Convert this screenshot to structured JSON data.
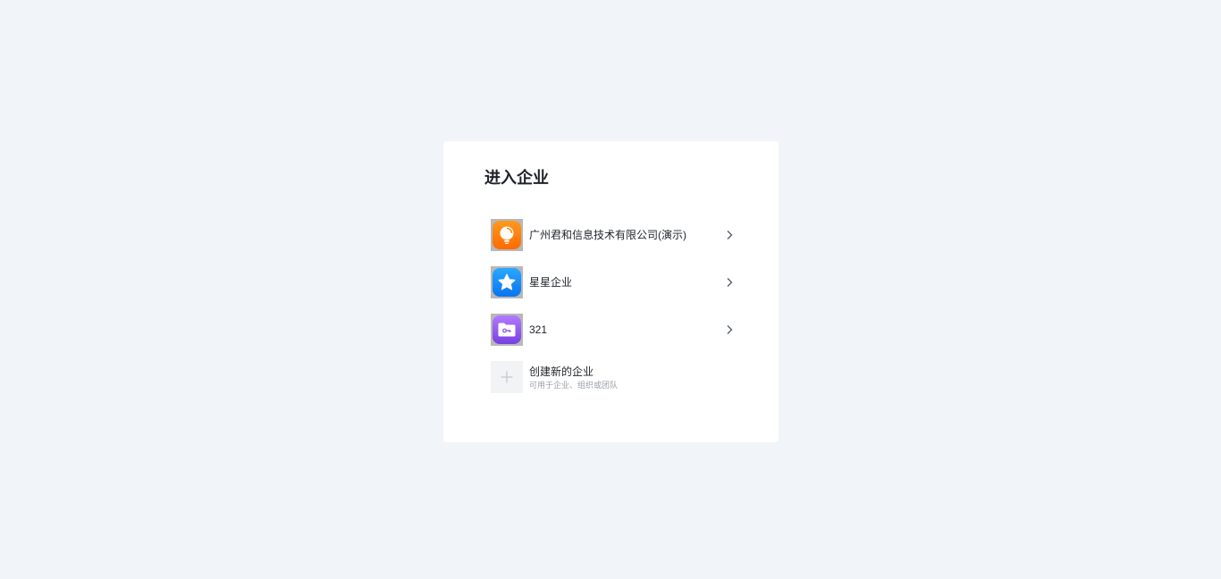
{
  "card": {
    "title": "进入企业"
  },
  "organizations": [
    {
      "name": "广州君和信息技术有限公司(演示)",
      "logo": "lightbulb-icon",
      "color": "#ff7a0a"
    },
    {
      "name": "星星企业",
      "logo": "star-icon",
      "color": "#1a8cff"
    },
    {
      "name": "321",
      "logo": "key-folder-icon",
      "color": "#9155f0"
    }
  ],
  "create": {
    "title": "创建新的企业",
    "subtitle": "可用于企业、组织或团队",
    "icon": "plus-icon"
  }
}
